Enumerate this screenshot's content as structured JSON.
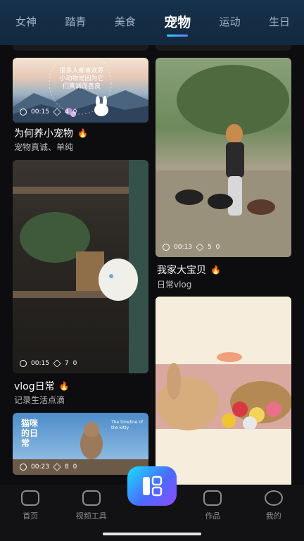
{
  "top_tabs": [
    {
      "label": "女神"
    },
    {
      "label": "踏青"
    },
    {
      "label": "美食"
    },
    {
      "label": "宠物",
      "active": true
    },
    {
      "label": "运动"
    },
    {
      "label": "生日"
    }
  ],
  "cards": {
    "why_pet": {
      "overlay_text": "很多人都喜欢养小动物是因为它们真诚而善良",
      "duration": "00:15",
      "clips": "4",
      "likes": "0",
      "title": "为何养小宠物",
      "subtitle": "宠物真诚、单纯"
    },
    "my_pet": {
      "duration": "00:13",
      "clips": "5",
      "likes": "0",
      "title": "我家大宝贝",
      "subtitle": "日常vlog"
    },
    "vlog": {
      "duration": "00:15",
      "clips": "7",
      "likes": "0",
      "title": "vlog日常",
      "subtitle": "记录生活点滴"
    },
    "cat_daily": {
      "overlay_left": "猫咪的日常",
      "overlay_right": "The timeline of the kitty",
      "duration": "00:23",
      "clips": "8",
      "likes": "0"
    }
  },
  "bottom_nav": [
    {
      "label": "首页",
      "icon": "home-icon"
    },
    {
      "label": "视频工具",
      "icon": "video-tool-icon"
    },
    {
      "label": "",
      "icon": "create-icon"
    },
    {
      "label": "作品",
      "icon": "works-icon"
    },
    {
      "label": "我的",
      "icon": "profile-icon"
    }
  ],
  "colors": {
    "accent_gradient_start": "#16e0ff",
    "accent_gradient_end": "#8b4bff",
    "fire": "#f59a1b"
  }
}
